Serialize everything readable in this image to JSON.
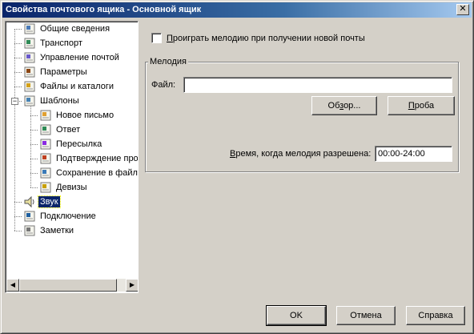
{
  "window": {
    "title": "Свойства почтового ящика - Основной ящик",
    "close_glyph": "✕"
  },
  "tree": {
    "items": [
      {
        "label": "Общие сведения",
        "icon": "general-info-icon"
      },
      {
        "label": "Транспорт",
        "icon": "transport-icon"
      },
      {
        "label": "Управление почтой",
        "icon": "mail-management-icon"
      },
      {
        "label": "Параметры",
        "icon": "parameters-icon"
      },
      {
        "label": "Файлы и каталоги",
        "icon": "files-folders-icon"
      },
      {
        "label": "Шаблоны",
        "icon": "templates-icon",
        "expanded": true
      },
      {
        "label": "Новое письмо",
        "icon": "new-letter-icon"
      },
      {
        "label": "Ответ",
        "icon": "reply-icon"
      },
      {
        "label": "Пересылка",
        "icon": "forward-icon"
      },
      {
        "label": "Подтверждение про",
        "icon": "confirmation-icon"
      },
      {
        "label": "Сохранение в файл",
        "icon": "save-to-file-icon"
      },
      {
        "label": "Девизы",
        "icon": "mottos-icon"
      },
      {
        "label": "Звук",
        "icon": "sound-icon",
        "selected": true
      },
      {
        "label": "Подключение",
        "icon": "connection-icon"
      },
      {
        "label": "Заметки",
        "icon": "notes-icon"
      }
    ],
    "expander_minus": "−",
    "scroll_left": "◀",
    "scroll_right": "▶"
  },
  "sound": {
    "play_checkbox_label": "Проиграть мелодию при получении новой почты",
    "play_checkbox_mnemonic": "П",
    "play_checkbox_rest": "роиграть мелодию при получении новой почты",
    "play_checked": false,
    "group_title": "Мелодия",
    "file_label": "Файл:",
    "file_value": "",
    "browse_label_pre": "Об",
    "browse_label_mn": "з",
    "browse_label_post": "ор...",
    "test_label_mn": "П",
    "test_label_post": "роба",
    "time_label_mn": "В",
    "time_label_post": "ремя, когда мелодия разрешена:",
    "time_value": "00:00-24:00"
  },
  "footer": {
    "ok": "OK",
    "cancel": "Отмена",
    "help": "Справка"
  },
  "colors": {
    "title_bar": "#0a246a",
    "selection": "#0a246a",
    "face": "#d4d0c8"
  }
}
